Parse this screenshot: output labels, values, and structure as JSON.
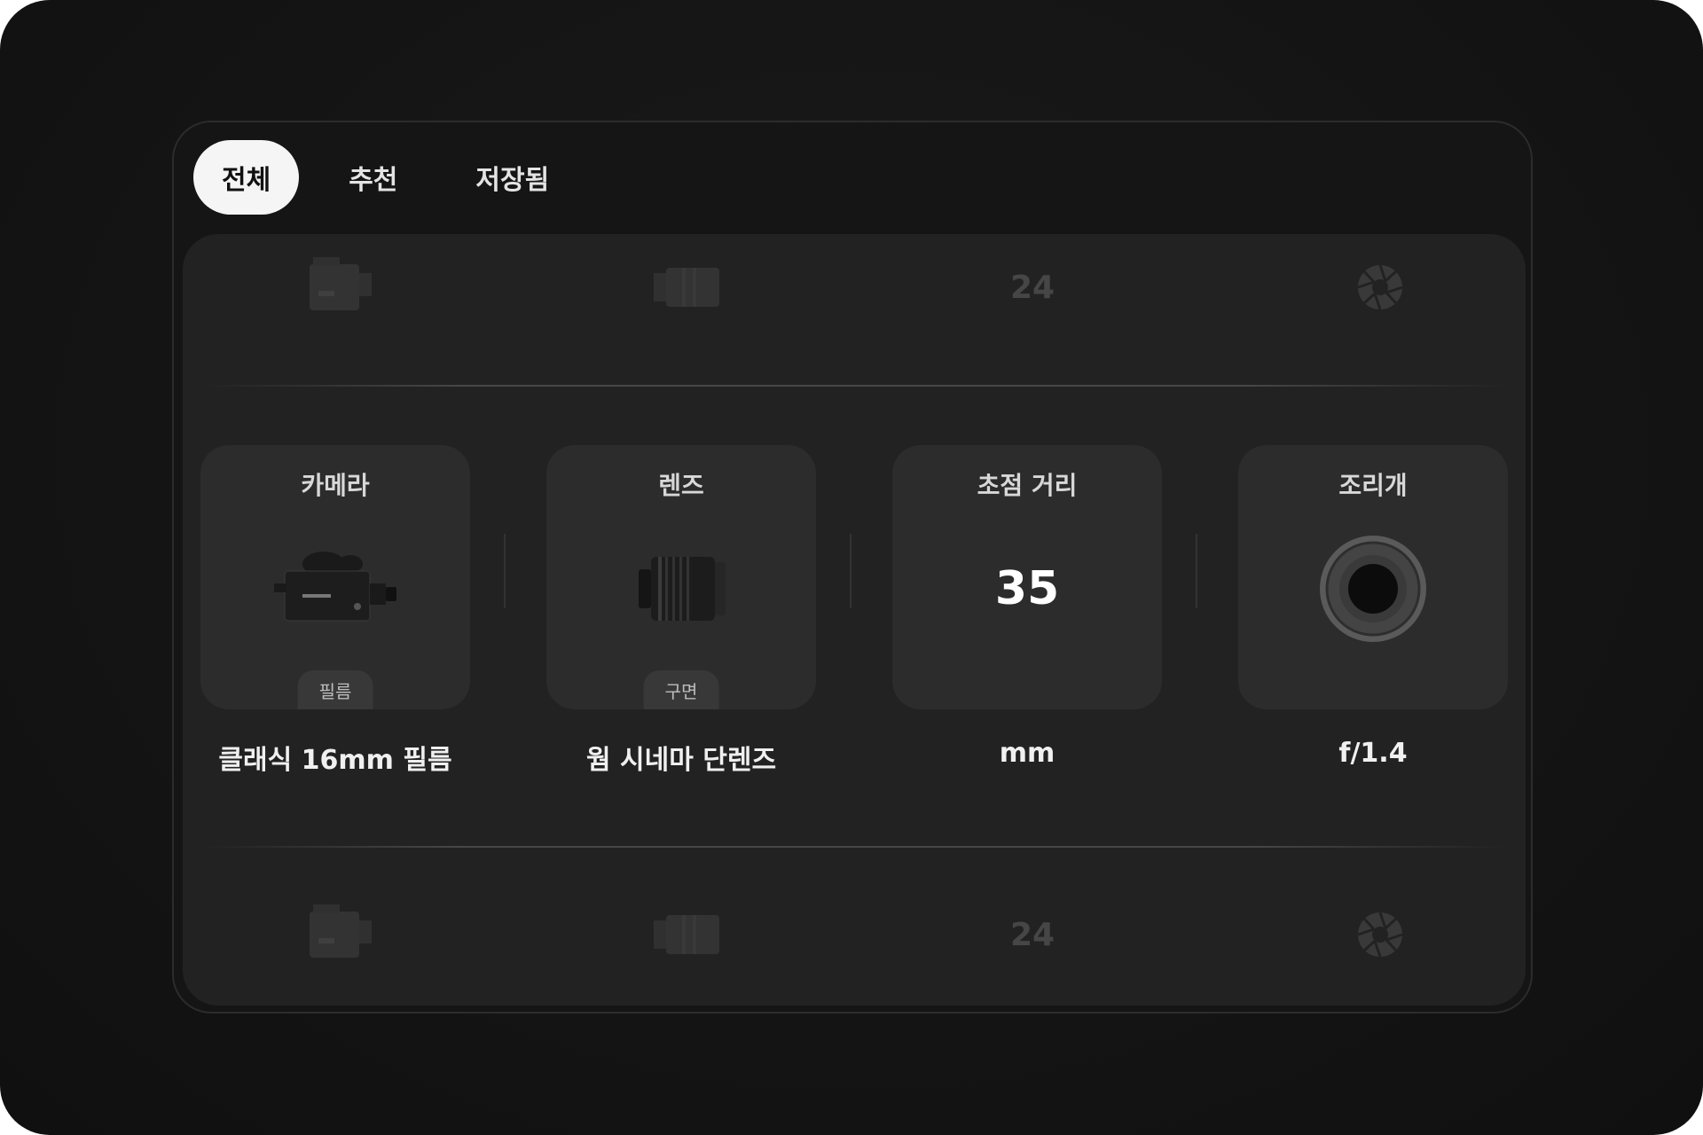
{
  "tabs": [
    {
      "label": "전체",
      "active": true
    },
    {
      "label": "추천",
      "active": false
    },
    {
      "label": "저장됨",
      "active": false
    }
  ],
  "ghost_rows": {
    "focal_number": "24",
    "icons": [
      "camera-icon",
      "lens-icon",
      "aperture-icon"
    ]
  },
  "settings": {
    "camera": {
      "title": "카메라",
      "tag": "필름",
      "value": "클래식 16mm 필름",
      "icon": "film-camera-icon"
    },
    "lens": {
      "title": "렌즈",
      "tag": "구면",
      "value": "웜 시네마 단렌즈",
      "icon": "cinema-lens-icon"
    },
    "focal": {
      "title": "초점 거리",
      "number": "35",
      "value": "mm"
    },
    "aperture": {
      "title": "조리개",
      "value": "f/1.4",
      "icon": "aperture-ring-icon"
    }
  },
  "colors": {
    "accent_tab_bg": "#f5f5f5",
    "background": "#151515",
    "card": "#2c2c2c"
  }
}
